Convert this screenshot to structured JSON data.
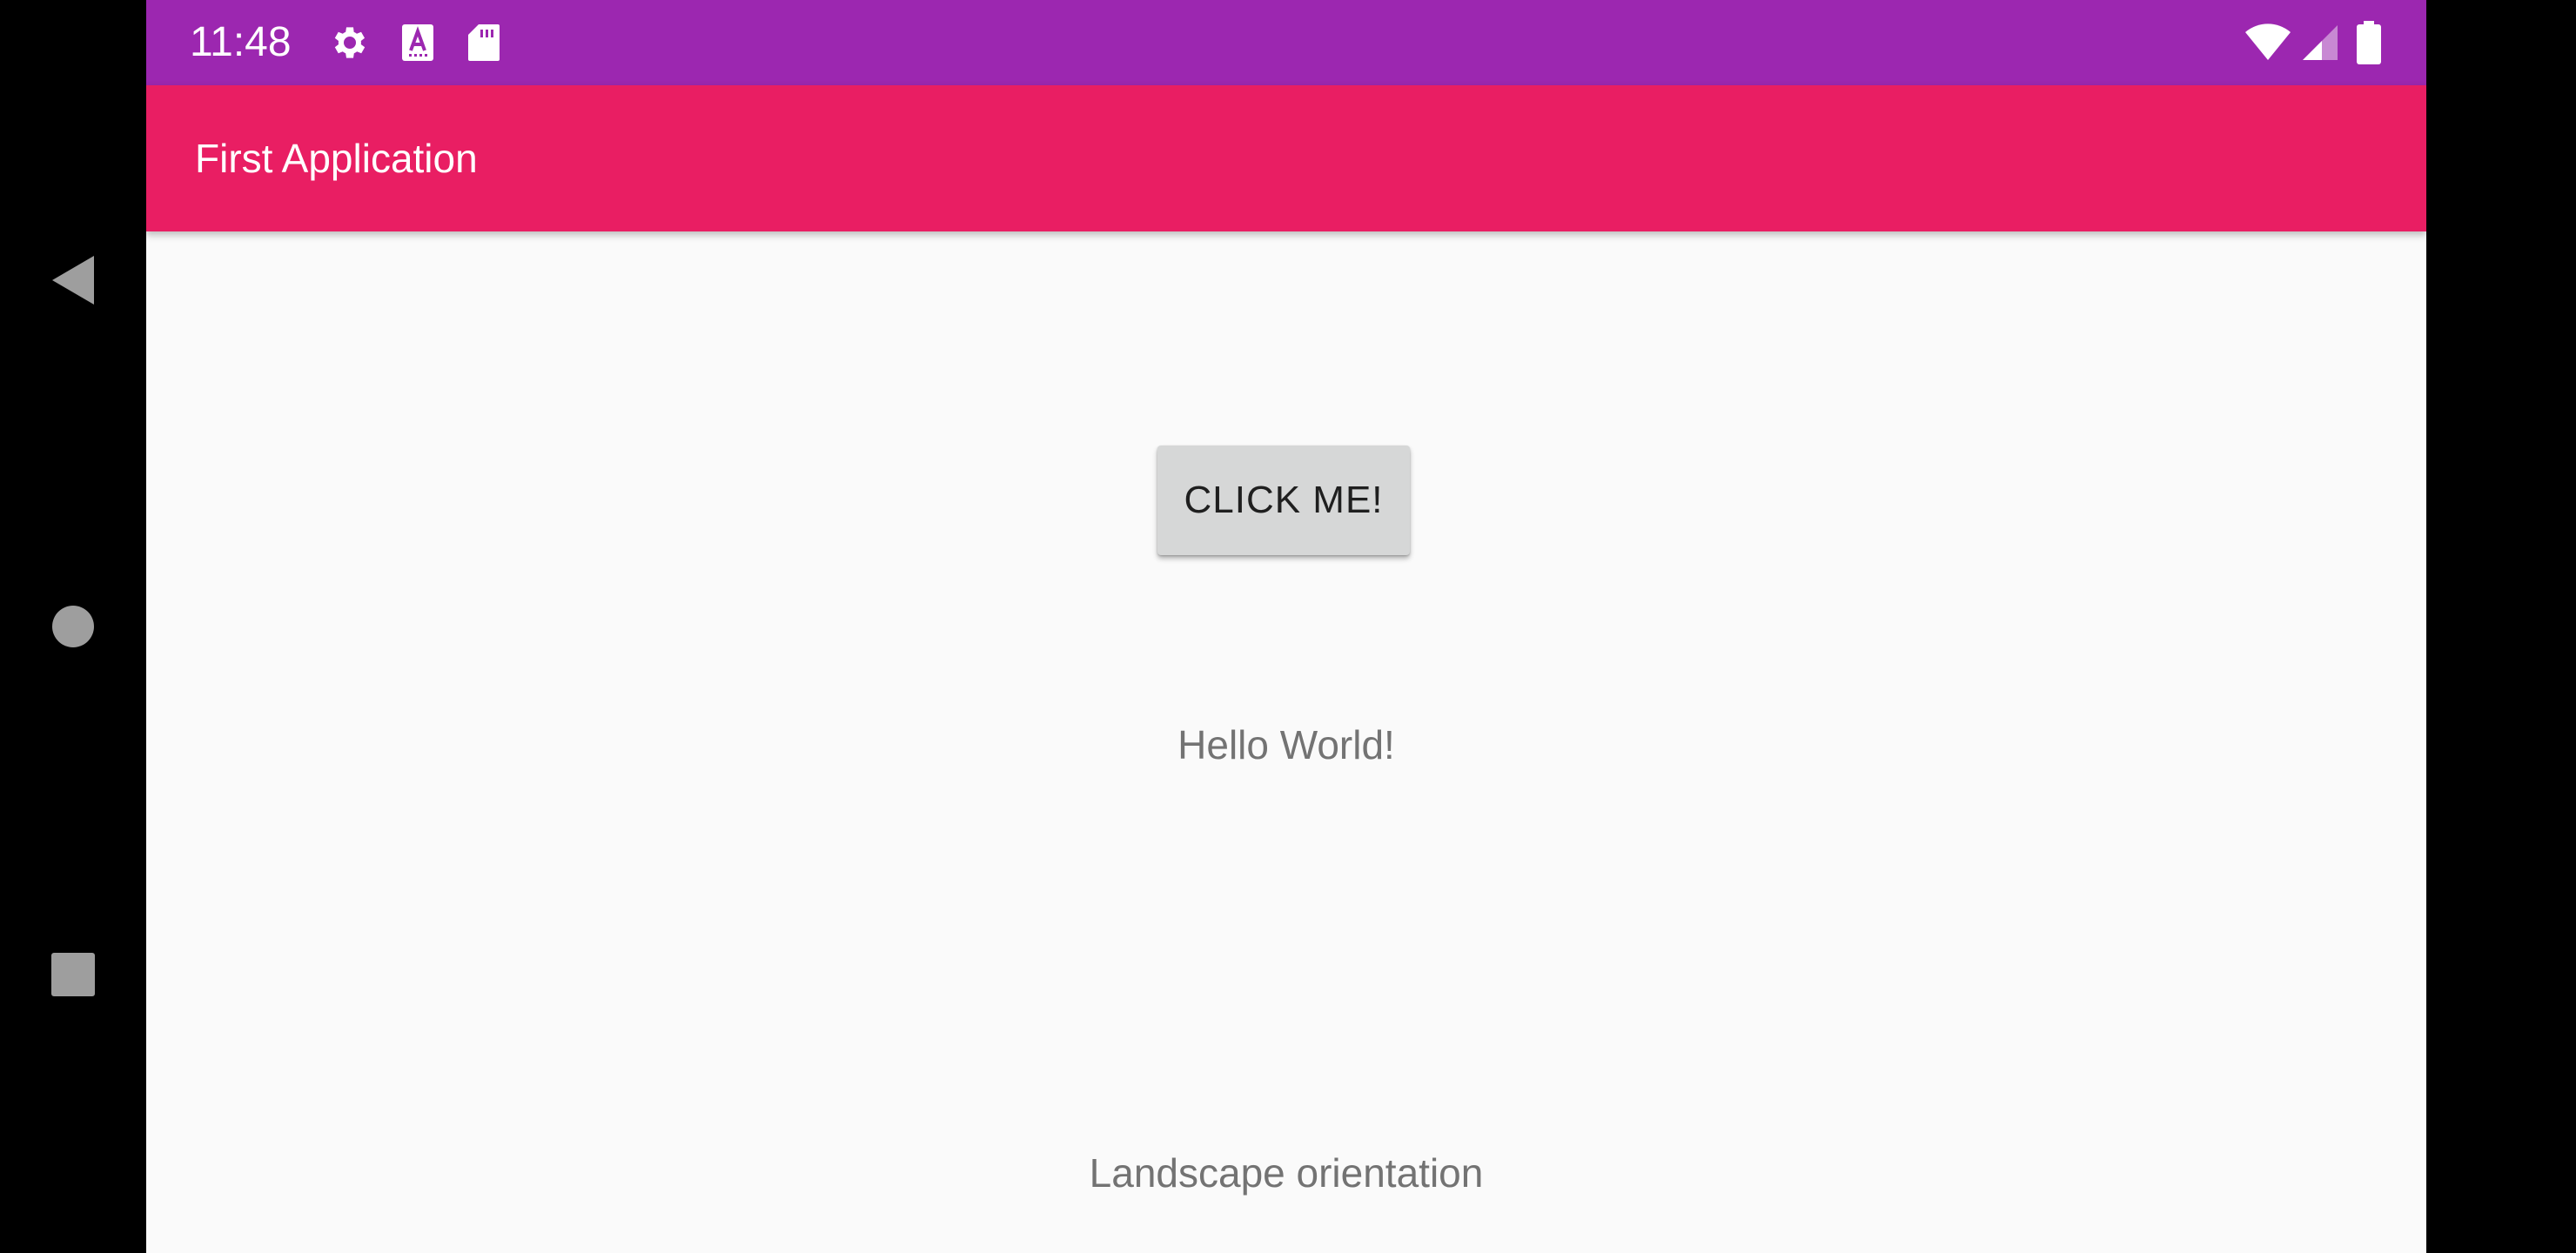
{
  "status_bar": {
    "time": "11:48",
    "left_icons": [
      "gear-icon",
      "keyboard-a-icon",
      "sd-card-icon"
    ],
    "right_icons": [
      "wifi-icon",
      "cell-signal-icon",
      "battery-icon"
    ],
    "color": "#9c27b0"
  },
  "app_bar": {
    "title": "First Application",
    "color": "#e91e63"
  },
  "main": {
    "button_label": "CLICK ME!",
    "hello_text": "Hello World!",
    "orientation_text": "Landscape orientation",
    "background": "#fafafa"
  },
  "nav_bar": {
    "buttons": [
      "back-icon",
      "home-icon",
      "recents-icon"
    ]
  }
}
